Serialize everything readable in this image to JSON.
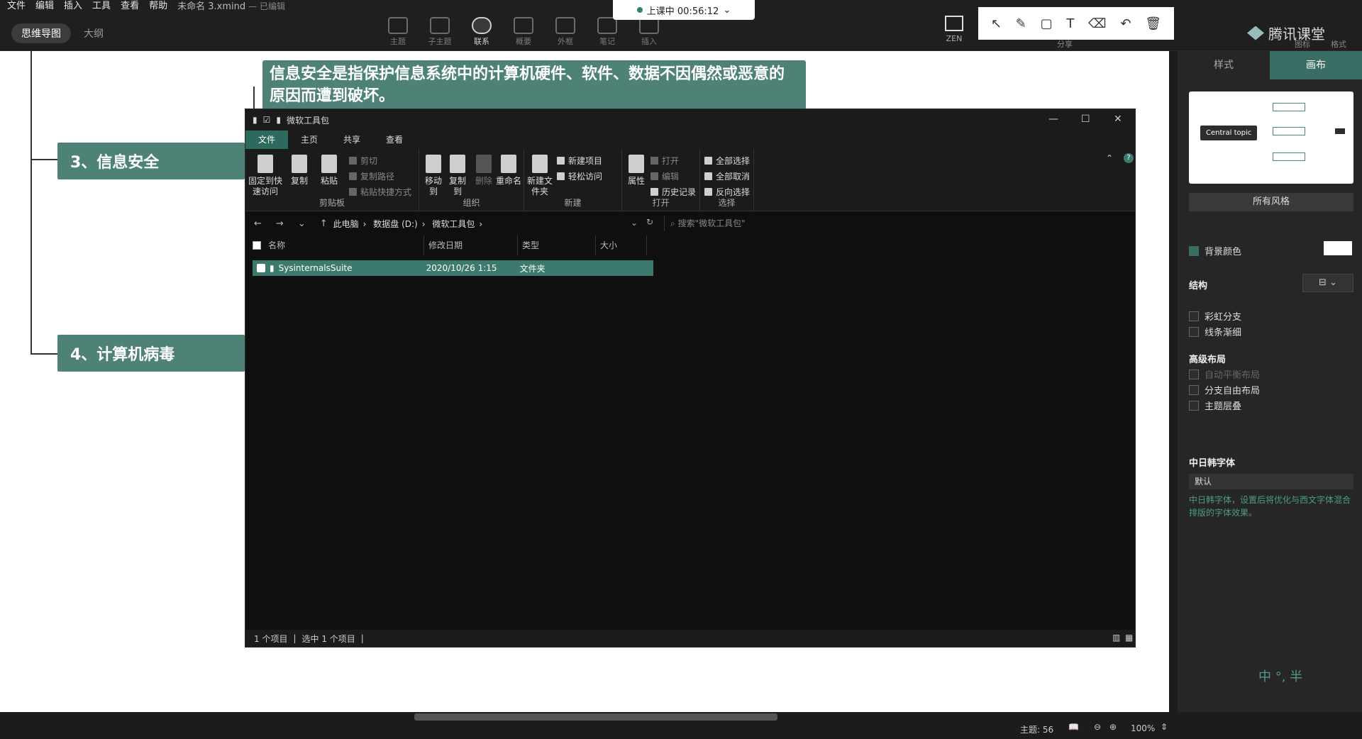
{
  "menu": {
    "file": "文件",
    "edit": "编辑",
    "insert": "插入",
    "tools": "工具",
    "view": "查看",
    "help": "帮助",
    "doc_title": "未命名 3.xmind",
    "doc_state": "— 已编辑"
  },
  "views": {
    "mindmap": "思维导图",
    "outline": "大纲"
  },
  "toolbar": {
    "topic": "主题",
    "subtopic": "子主题",
    "relation": "联系",
    "summary": "概要",
    "boundary": "外框",
    "note": "笔记",
    "insert": "插入",
    "zen": "ZEN"
  },
  "class_status": {
    "label": "上课中 00:56:12"
  },
  "brand": {
    "name": "腾讯课堂",
    "share": "分享",
    "icon_label": "图标",
    "format_label": "格式"
  },
  "canvas": {
    "note_text": "信息安全是指保护信息系统中的计算机硬件、软件、数据不因偶然或恶意的原因而遭到破坏。",
    "topic3": "3、信息安全",
    "topic4": "4、计算机病毒"
  },
  "explorer": {
    "title": "微软工具包",
    "tabs": {
      "file": "文件",
      "home": "主页",
      "share": "共享",
      "view": "查看"
    },
    "ribbon": {
      "pin": "固定到快速访问",
      "copy": "复制",
      "paste": "粘贴",
      "cut": "剪切",
      "copy_path": "复制路径",
      "paste_shortcut": "粘贴快捷方式",
      "clipboard": "剪贴板",
      "move_to": "移动到",
      "copy_to": "复制到",
      "delete": "删除",
      "rename": "重命名",
      "organize": "组织",
      "new_folder": "新建文件夹",
      "new_item": "新建项目",
      "easy_access": "轻松访问",
      "new": "新建",
      "properties": "属性",
      "open": "打开",
      "edit": "编辑",
      "history": "历史记录",
      "open_group": "打开",
      "select_all": "全部选择",
      "select_none": "全部取消",
      "invert": "反向选择",
      "select": "选择"
    },
    "breadcrumb": {
      "pc": "此电脑",
      "drive": "数据盘 (D:)",
      "folder": "微软工具包"
    },
    "search_placeholder": "搜索\"微软工具包\"",
    "columns": {
      "name": "名称",
      "date": "修改日期",
      "type": "类型",
      "size": "大小"
    },
    "rows": [
      {
        "name": "SysinternalsSuite",
        "date": "2020/10/26 1:15",
        "type": "文件夹",
        "size": ""
      }
    ],
    "status": {
      "count": "1 个项目",
      "selected": "选中 1 个项目"
    }
  },
  "panel": {
    "tab_style": "样式",
    "tab_canvas": "画布",
    "central_topic": "Central topic",
    "all_styles": "所有风格",
    "bg_color": "背景颜色",
    "structure": "结构",
    "rainbow": "彩虹分支",
    "taper": "线条渐细",
    "advanced": "高级布局",
    "auto_balance": "自动平衡布局",
    "free_branch": "分支自由布局",
    "topic_overlap": "主题层叠",
    "cjk_font": "中日韩字体",
    "cjk_value": "默认",
    "cjk_desc": "中日韩字体，设置后将优化与西文字体混合排版的字体效果。",
    "ime": "中 °, 半"
  },
  "bottom": {
    "topics": "主题: 56",
    "zoom": "100%"
  }
}
